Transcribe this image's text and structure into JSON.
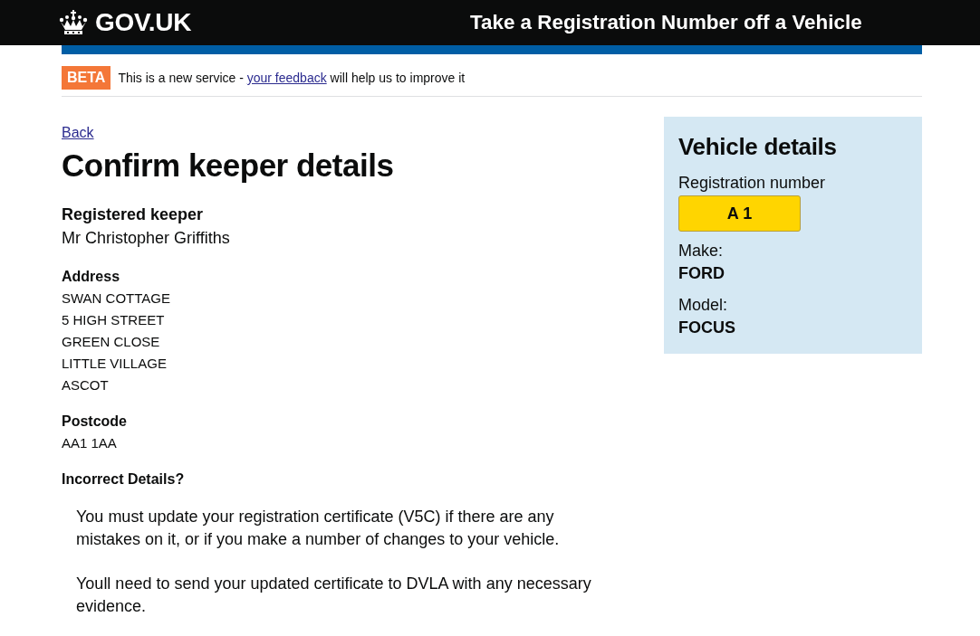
{
  "header": {
    "logo": "GOV.UK",
    "service_name": "Take a Registration Number off a Vehicle"
  },
  "phase_banner": {
    "tag": "BETA",
    "text_before": "This is a new service -",
    "link": "your feedback",
    "text_after": "will help us to improve it"
  },
  "back_link": "Back",
  "heading": "Confirm keeper details",
  "keeper": {
    "label": "Registered keeper",
    "name": "Mr Christopher Griffiths"
  },
  "address": {
    "label": "Address",
    "lines": [
      "SWAN COTTAGE",
      "5 HIGH STREET",
      "GREEN CLOSE",
      "LITTLE VILLAGE",
      "ASCOT"
    ]
  },
  "postcode": {
    "label": "Postcode",
    "value": "AA1 1AA"
  },
  "incorrect_details": {
    "label": "Incorrect Details?",
    "paragraphs": [
      "You must update your registration certificate (V5C) if there are any mistakes on it, or if you make a number of changes to your vehicle.",
      "Youll need to send your updated certificate to DVLA with any necessary evidence."
    ]
  },
  "vehicle_details": {
    "title": "Vehicle details",
    "registration_label": "Registration number",
    "registration_number": "A 1",
    "fields": [
      {
        "label": "Make:",
        "value": "FORD"
      },
      {
        "label": "Model:",
        "value": "FOCUS"
      }
    ]
  }
}
